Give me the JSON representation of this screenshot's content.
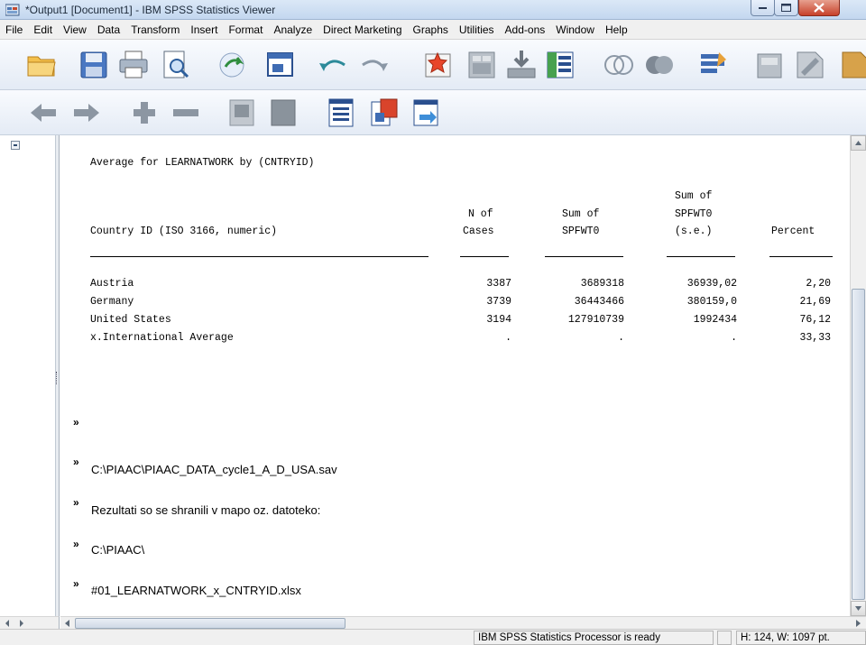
{
  "window": {
    "title": "*Output1 [Document1] - IBM SPSS Statistics Viewer"
  },
  "menu": [
    "File",
    "Edit",
    "View",
    "Data",
    "Transform",
    "Insert",
    "Format",
    "Analyze",
    "Direct Marketing",
    "Graphs",
    "Utilities",
    "Add-ons",
    "Window",
    "Help"
  ],
  "toolbar1": [
    "open-folder-icon",
    "save-icon",
    "print-icon",
    "print-preview-icon",
    "export-icon",
    "recall-dialog-icon",
    "undo-icon",
    "redo-icon",
    "goto-data-icon",
    "goto-case-icon",
    "goto-variable-icon",
    "variables-icon",
    "use-variable-sets-icon",
    "show-all-variables-icon",
    "spelling-icon",
    "insert-output-icon",
    "insert-text-icon",
    "insert-title-icon"
  ],
  "toolbar2": [
    "back-icon",
    "forward-icon",
    "expand-icon",
    "collapse-icon",
    "show-icon",
    "hide-icon",
    "insert-heading-icon",
    "insert-output-page-icon",
    "designate-window-icon"
  ],
  "output": {
    "heading": "Average for LEARNATWORK by (CNTRYID)",
    "columns": {
      "country": "Country ID (ISO 3166, numeric)",
      "n_cases_1": "N of",
      "n_cases_2": "Cases",
      "sum_1": "Sum of",
      "sum_2": "SPFWT0",
      "se_1": "Sum of",
      "se_2": "SPFWT0",
      "se_3": "(s.e.)",
      "percent": "Percent"
    },
    "rows": [
      {
        "country": "Austria",
        "n": "3387",
        "sum": "3689318",
        "se": "36939,02",
        "pct": "2,20"
      },
      {
        "country": "Germany",
        "n": "3739",
        "sum": "36443466",
        "se": "380159,0",
        "pct": "21,69"
      },
      {
        "country": "United States",
        "n": "3194",
        "sum": "127910739",
        "se": "1992434",
        "pct": "76,12"
      },
      {
        "country": "x.International Average",
        "n": ".",
        "sum": ".",
        "se": ".",
        "pct": "33,33"
      }
    ]
  },
  "log": {
    "chevron": "»",
    "lines": [
      "",
      "C:\\PIAAC\\PIAAC_DATA_cycle1_A_D_USA.sav",
      "Rezultati so se shranili v mapo oz. datoteko:",
      "C:\\PIAAC\\",
      "#01_LEARNATWORK_x_CNTRYID.xlsx"
    ]
  },
  "status": {
    "processor": "IBM SPSS Statistics Processor is ready",
    "dimensions": "H: 124, W: 1097 pt."
  }
}
